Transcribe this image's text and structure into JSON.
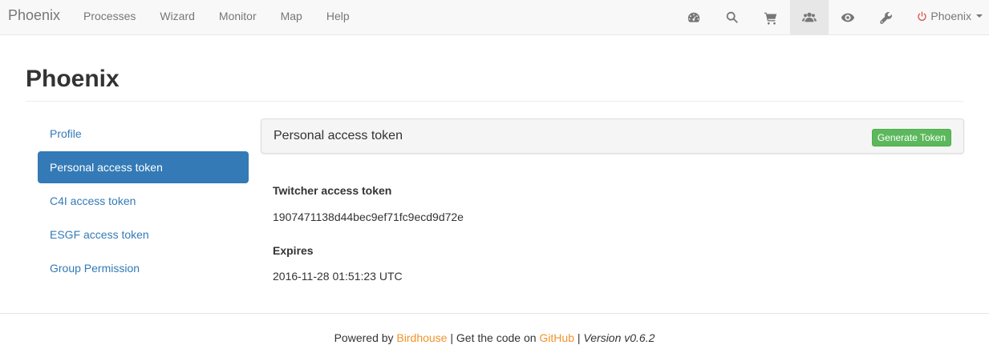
{
  "navbar": {
    "brand": "Phoenix",
    "items": [
      {
        "label": "Processes"
      },
      {
        "label": "Wizard"
      },
      {
        "label": "Monitor"
      },
      {
        "label": "Map"
      },
      {
        "label": "Help"
      }
    ],
    "icons": [
      "dashboard-icon",
      "search-icon",
      "cart-icon",
      "users-icon",
      "eye-icon",
      "wrench-icon"
    ],
    "active_icon": "users-icon",
    "user_label": "Phoenix",
    "user_icon": "power-icon",
    "user_icon_color": "#d9534f"
  },
  "page": {
    "title": "Phoenix"
  },
  "sidebar": {
    "items": [
      {
        "label": "Profile",
        "active": false
      },
      {
        "label": "Personal access token",
        "active": true
      },
      {
        "label": "C4I access token",
        "active": false
      },
      {
        "label": "ESGF access token",
        "active": false
      },
      {
        "label": "Group Permission",
        "active": false
      }
    ],
    "active_color": "#337ab7"
  },
  "panel": {
    "title": "Personal access token",
    "button_label": "Generate Token",
    "button_color": "#5cb85c"
  },
  "token": {
    "label": "Twitcher access token",
    "value": "1907471138d44bec9ef71fc9ecd9d72e",
    "expires_label": "Expires",
    "expires_value": "2016-11-28 01:51:23 UTC"
  },
  "footer": {
    "powered_by": "Powered by",
    "birdhouse_link": "Birdhouse",
    "separator1": "|",
    "get_code": "Get the code on",
    "github_link": "GitHub",
    "separator2": "|",
    "version": "Version v0.6.2",
    "link_color": "#f0932b"
  }
}
